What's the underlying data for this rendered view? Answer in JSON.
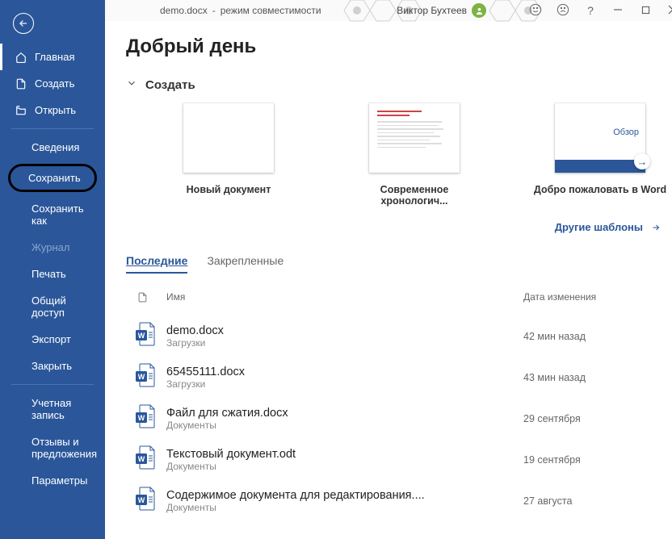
{
  "titlebar": {
    "filename": "demo.docx",
    "sep": "-",
    "mode": "режим совместимости",
    "user": "Виктор Бухтеев"
  },
  "sidebar": {
    "home": "Главная",
    "create": "Создать",
    "open": "Открыть",
    "info": "Сведения",
    "save": "Сохранить",
    "save_as": "Сохранить как",
    "journal": "Журнал",
    "print": "Печать",
    "share": "Общий доступ",
    "export": "Экспорт",
    "close": "Закрыть",
    "account": "Учетная запись",
    "feedback1": "Отзывы и",
    "feedback2": "предложения",
    "options": "Параметры"
  },
  "main": {
    "greeting": "Добрый день",
    "create_section": "Создать",
    "templates": [
      {
        "label": "Новый документ"
      },
      {
        "label": "Современное хронологич..."
      },
      {
        "label": "Добро пожаловать в Word",
        "overlay": "Обзор"
      }
    ],
    "more_templates": "Другие шаблоны",
    "tabs": {
      "recent": "Последние",
      "pinned": "Закрепленные"
    },
    "list_headers": {
      "name": "Имя",
      "date": "Дата изменения"
    },
    "files": [
      {
        "name": "demo.docx",
        "location": "Загрузки",
        "date": "42 мин назад"
      },
      {
        "name": "65455111.docx",
        "location": "Загрузки",
        "date": "43 мин назад"
      },
      {
        "name": "Файл для сжатия.docx",
        "location": "Документы",
        "date": "29 сентября"
      },
      {
        "name": "Текстовый документ.odt",
        "location": "Документы",
        "date": "19 сентября"
      },
      {
        "name": "Содержимое документа для редактирования....",
        "location": "Документы",
        "date": "27 августа"
      }
    ]
  }
}
